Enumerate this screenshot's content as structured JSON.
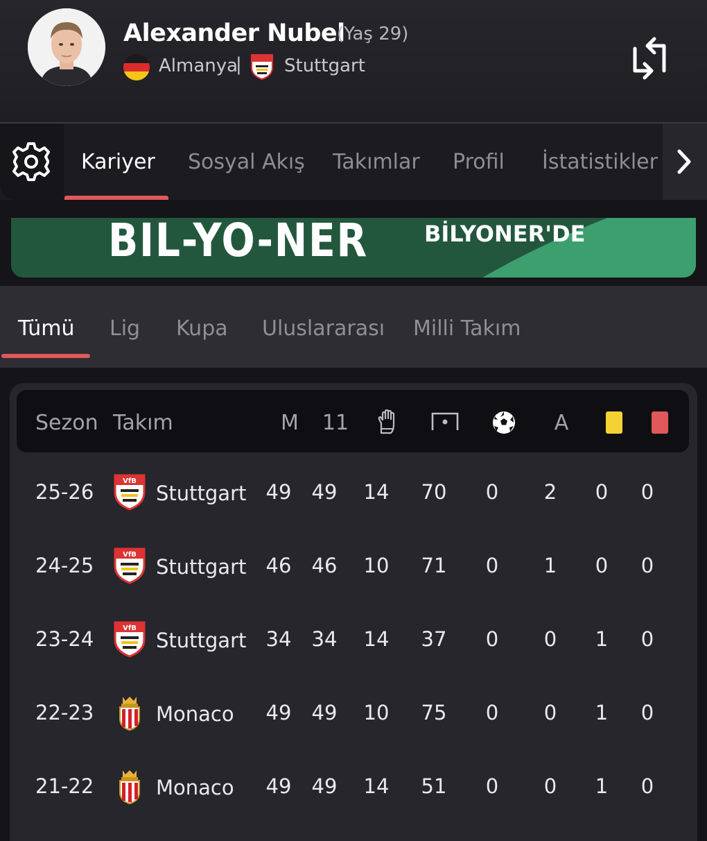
{
  "header": {
    "player_name": "Alexander Nubel",
    "age_label": "(Yaş 29)",
    "nationality": "Almanya",
    "separator": "|",
    "club": "Stuttgart"
  },
  "tabs": [
    {
      "label": "Kariyer",
      "active": true
    },
    {
      "label": "Sosyal Akış",
      "active": false
    },
    {
      "label": "Takımlar",
      "active": false
    },
    {
      "label": "Profil",
      "active": false
    },
    {
      "label": "İstatistikler",
      "active": false
    }
  ],
  "banner": {
    "left_text": "BIL-YO-NER",
    "right_text": "BİLYONER'DE",
    "colors": {
      "dark": "#22573e",
      "light": "#3d9e6e"
    }
  },
  "filter_tabs": [
    {
      "label": "Tümü",
      "active": true
    },
    {
      "label": "Lig",
      "active": false
    },
    {
      "label": "Kupa",
      "active": false
    },
    {
      "label": "Uluslararası",
      "active": false
    },
    {
      "label": "Milli Takım",
      "active": false
    }
  ],
  "table": {
    "headers": {
      "season": "Sezon",
      "team": "Takım",
      "matches": "M",
      "starts": "11",
      "clean_sheets_icon": "goalkeeper-glove-icon",
      "goals_conceded_icon": "goal-net-icon",
      "goals_icon": "football-icon",
      "assists": "A",
      "yellow_icon": "yellow-card-icon",
      "red_icon": "red-card-icon"
    },
    "rows": [
      {
        "season": "25-26",
        "team": "Stuttgart",
        "crest": "vfb-stuttgart-crest",
        "m": "49",
        "starts": "49",
        "clean": "14",
        "conceded": "70",
        "goals": "0",
        "assists": "2",
        "yellow": "0",
        "red": "0"
      },
      {
        "season": "24-25",
        "team": "Stuttgart",
        "crest": "vfb-stuttgart-crest",
        "m": "46",
        "starts": "46",
        "clean": "10",
        "conceded": "71",
        "goals": "0",
        "assists": "1",
        "yellow": "0",
        "red": "0"
      },
      {
        "season": "23-24",
        "team": "Stuttgart",
        "crest": "vfb-stuttgart-crest",
        "m": "34",
        "starts": "34",
        "clean": "14",
        "conceded": "37",
        "goals": "0",
        "assists": "0",
        "yellow": "1",
        "red": "0"
      },
      {
        "season": "22-23",
        "team": "Monaco",
        "crest": "as-monaco-crest",
        "m": "49",
        "starts": "49",
        "clean": "10",
        "conceded": "75",
        "goals": "0",
        "assists": "0",
        "yellow": "1",
        "red": "0"
      },
      {
        "season": "21-22",
        "team": "Monaco",
        "crest": "as-monaco-crest",
        "m": "49",
        "starts": "49",
        "clean": "14",
        "conceded": "51",
        "goals": "0",
        "assists": "0",
        "yellow": "1",
        "red": "0"
      }
    ]
  },
  "colors": {
    "accent": "#e0585a",
    "yellow_card": "#f4d234",
    "red_card": "#e0585a",
    "background": "#141419",
    "row": "#26262c"
  }
}
